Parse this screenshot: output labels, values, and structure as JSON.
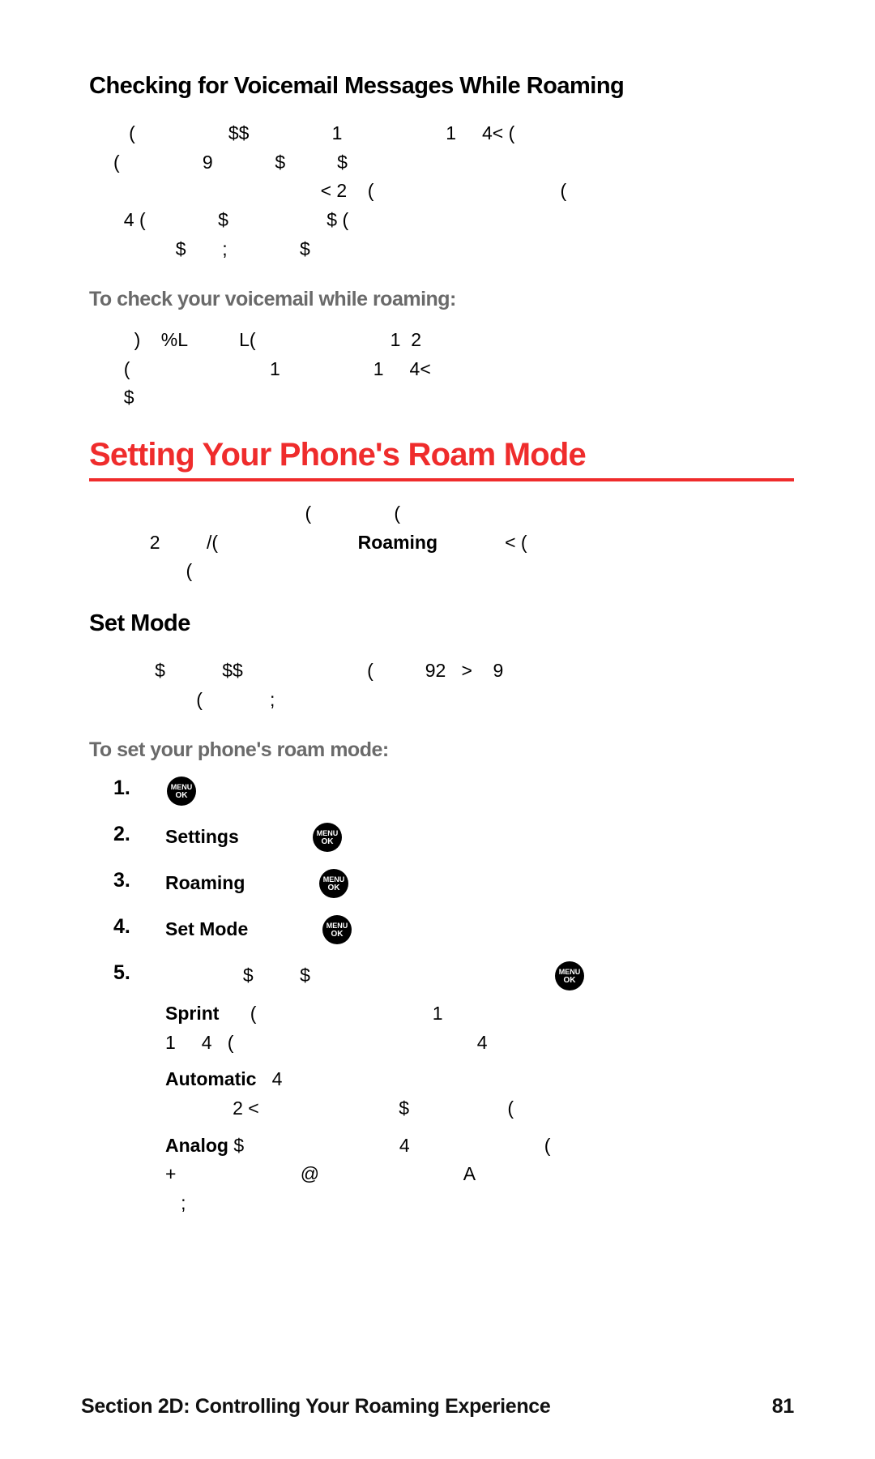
{
  "subheading_voicemail": "Checking for Voicemail Messages While Roaming",
  "para_voicemail_1": "   (                  $$                1                    1     4< (\n(                9            $          $\n                                        < 2    (                                    (\n  4 (              $                   $ (\n            $       ;              $",
  "lead_check": "To check your voicemail while roaming:",
  "para_voicemail_2": "    )    %L          L(                          1  2\n  (                           1                  1     4<\n  $",
  "section_title": "Setting Your Phone's Roam Mode",
  "para_roam_intro": "                                     (                (\n       2         /(                           Roaming             < (\n              (",
  "subheading_setmode": "Set Mode",
  "para_setmode": "        $           $$                        (          92   >    9\n                (             ;",
  "lead_setmode": "To set your phone's roam mode:",
  "steps": [
    {
      "num": "1.",
      "prefix": "",
      "bold": "",
      "suffix": "",
      "icon": true,
      "icon_pos": "start"
    },
    {
      "num": "2.",
      "prefix": "",
      "bold": "Settings",
      "suffix": "             ",
      "icon": true,
      "icon_pos": "end"
    },
    {
      "num": "3.",
      "prefix": "",
      "bold": "Roaming",
      "suffix": "             ",
      "icon": true,
      "icon_pos": "end"
    },
    {
      "num": "4.",
      "prefix": "",
      "bold": "Set Mode",
      "suffix": "             ",
      "icon": true,
      "icon_pos": "end"
    }
  ],
  "step5_num": "5.",
  "step5_line": "               $         $                                              ",
  "bullets": [
    {
      "label": "Sprint",
      "text": "      (                                  1\n1     4   (                                               4"
    },
    {
      "label": "Automatic",
      "text": "   4\n             2 <                           $                   ("
    },
    {
      "label": "Analog",
      "text": " $                              4                          (\n+                        @                            A\n   ;"
    }
  ],
  "footer_left": "Section 2D: Controlling Your Roaming Experience",
  "footer_right": "81"
}
